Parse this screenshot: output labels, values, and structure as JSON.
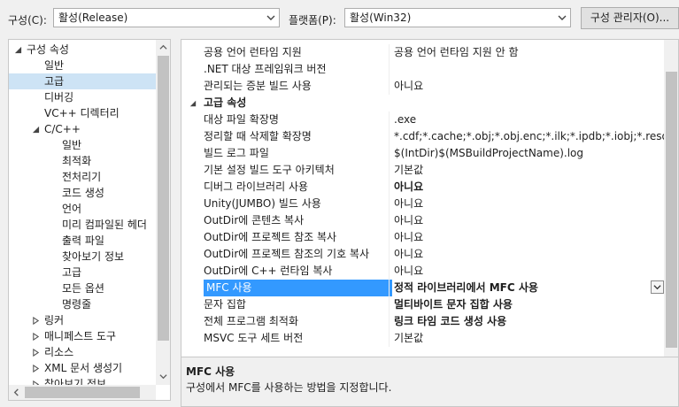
{
  "toolbar": {
    "config_label": "구성(C):",
    "config_value": "활성(Release)",
    "platform_label": "플랫폼(P):",
    "platform_value": "활성(Win32)",
    "config_manager_button": "구성 관리자(O)..."
  },
  "tree": {
    "items": [
      {
        "label": "구성 속성",
        "expander": "expanded"
      },
      {
        "label": "일반"
      },
      {
        "label": "고급",
        "selected": true
      },
      {
        "label": "디버깅"
      },
      {
        "label": "VC++ 디렉터리"
      },
      {
        "label": "C/C++",
        "expander": "expanded"
      },
      {
        "label": "일반"
      },
      {
        "label": "최적화"
      },
      {
        "label": "전처리기"
      },
      {
        "label": "코드 생성"
      },
      {
        "label": "언어"
      },
      {
        "label": "미리 컴파일된 헤더"
      },
      {
        "label": "출력 파일"
      },
      {
        "label": "찾아보기 정보"
      },
      {
        "label": "고급"
      },
      {
        "label": "모든 옵션"
      },
      {
        "label": "명령줄"
      },
      {
        "label": "링커",
        "expander": "collapsed"
      },
      {
        "label": "매니페스트 도구",
        "expander": "collapsed"
      },
      {
        "label": "리소스",
        "expander": "collapsed"
      },
      {
        "label": "XML 문서 생성기",
        "expander": "collapsed"
      },
      {
        "label": "찾아보기 정보",
        "expander": "collapsed"
      }
    ]
  },
  "grid": {
    "rows_top": [
      {
        "name": "공용 언어 런타임 지원",
        "value": "공용 언어 런타임 지원 안 함"
      },
      {
        "name": ".NET 대상 프레임워크 버전",
        "value": ""
      },
      {
        "name": "관리되는 증분 빌드 사용",
        "value": "아니요"
      }
    ],
    "category": "고급 속성",
    "rows": [
      {
        "name": "대상 파일 확장명",
        "value": ".exe"
      },
      {
        "name": "정리할 때 삭제할 확장명",
        "value": "*.cdf;*.cache;*.obj;*.obj.enc;*.ilk;*.ipdb;*.iobj;*.resources;*.t"
      },
      {
        "name": "빌드 로그 파일",
        "value": "$(IntDir)$(MSBuildProjectName).log"
      },
      {
        "name": "기본 설정 빌드 도구 아키텍처",
        "value": "기본값"
      },
      {
        "name": "디버그 라이브러리 사용",
        "value": "아니요",
        "bold": true
      },
      {
        "name": "Unity(JUMBO) 빌드 사용",
        "value": "아니요"
      },
      {
        "name": "OutDir에 콘텐츠 복사",
        "value": "아니요"
      },
      {
        "name": "OutDir에 프로젝트 참조 복사",
        "value": "아니요"
      },
      {
        "name": "OutDir에 프로젝트 참조의 기호 복사",
        "value": "아니요"
      },
      {
        "name": "OutDir에 C++ 런타임 복사",
        "value": "아니요"
      },
      {
        "name": "MFC 사용",
        "value": "정적 라이브러리에서 MFC 사용",
        "bold": true,
        "selected": true
      },
      {
        "name": "문자 집합",
        "value": "멀티바이트 문자 집합 사용",
        "bold": true
      },
      {
        "name": "전체 프로그램 최적화",
        "value": "링크 타임 코드 생성 사용",
        "bold": true
      },
      {
        "name": "MSVC 도구 세트 버전",
        "value": "기본값"
      }
    ]
  },
  "description": {
    "title": "MFC 사용",
    "text": "구성에서 MFC를 사용하는 방법을 지정합니다."
  },
  "colors": {
    "selection_blue": "#3399ff",
    "tree_selection": "#cde3f5",
    "window_bg": "#f0f0f0"
  }
}
